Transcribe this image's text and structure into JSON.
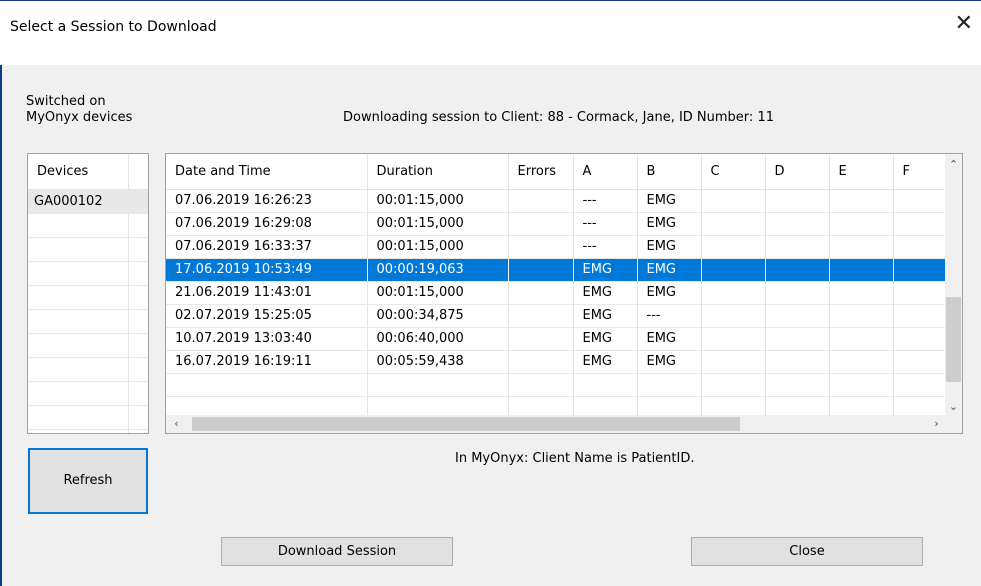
{
  "window": {
    "title": "Select a Session to Download",
    "close_glyph": "✕"
  },
  "labels": {
    "switched_on_line1": "Switched on",
    "switched_on_line2": "MyOnyx devices",
    "downloading_info": "Downloading session to Client: 88 - Cormack, Jane, ID Number: 11",
    "client_name_info": "In MyOnyx: Client Name is PatientID."
  },
  "devices": {
    "header": "Devices",
    "items": [
      "GA000102"
    ]
  },
  "sessions": {
    "columns": [
      "Date and Time",
      "Duration",
      "Errors",
      "A",
      "B",
      "C",
      "D",
      "E",
      "F"
    ],
    "rows": [
      [
        "07.06.2019 16:26:23",
        "00:01:15,000",
        "",
        "---",
        "EMG",
        "",
        "",
        "",
        ""
      ],
      [
        "07.06.2019 16:29:08",
        "00:01:15,000",
        "",
        "---",
        "EMG",
        "",
        "",
        "",
        ""
      ],
      [
        "07.06.2019 16:33:37",
        "00:01:15,000",
        "",
        "---",
        "EMG",
        "",
        "",
        "",
        ""
      ],
      [
        "17.06.2019 10:53:49",
        "00:00:19,063",
        "",
        "EMG",
        "EMG",
        "",
        "",
        "",
        ""
      ],
      [
        "21.06.2019 11:43:01",
        "00:01:15,000",
        "",
        "EMG",
        "EMG",
        "",
        "",
        "",
        ""
      ],
      [
        "02.07.2019 15:25:05",
        "00:00:34,875",
        "",
        "EMG",
        "---",
        "",
        "",
        "",
        ""
      ],
      [
        "10.07.2019 13:03:40",
        "00:06:40,000",
        "",
        "EMG",
        "EMG",
        "",
        "",
        "",
        ""
      ],
      [
        "16.07.2019 16:19:11",
        "00:05:59,438",
        "",
        "EMG",
        "EMG",
        "",
        "",
        "",
        ""
      ]
    ],
    "selected_row": 3
  },
  "scroll_arrows": {
    "up": "⌃",
    "down": "⌄",
    "left": "‹",
    "right": "›"
  },
  "buttons": {
    "refresh": "Refresh",
    "download": "Download Session",
    "close": "Close"
  },
  "colors": {
    "selection": "#0078d7",
    "default_button_border": "#0078d7"
  }
}
